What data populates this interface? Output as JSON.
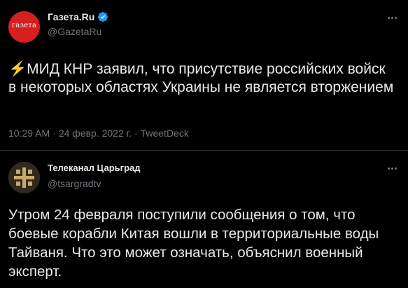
{
  "tweet1": {
    "avatar_text": "газета",
    "name": "Газета.Ru",
    "handle": "@GazetaRu",
    "bolt": "⚡",
    "text": "МИД КНР заявил, что присутствие российских войск в некоторых областях Украины не является вторжением",
    "time": "10:29 AM",
    "date": "24 февр. 2022 г.",
    "source": "TweetDeck",
    "separator": "·",
    "icons": {
      "verified": "verified-badge-icon",
      "more": "more-dots-icon"
    }
  },
  "tweet2": {
    "name": "Телеканал Царьград",
    "handle": "@tsargradtv",
    "text": "Утром 24 февраля поступили сообщения о том, что боевые корабли Китая вошли в территориальные воды Тайваня. Что это может означать, объяснил военный эксперт.",
    "icons": {
      "logo": "cross-emblem-icon",
      "more": "more-dots-icon"
    }
  },
  "colors": {
    "background": "#000000",
    "text": "#e7e9ea",
    "muted": "#71767b",
    "verified": "#1d9bf0",
    "gazeta_red": "#d61f1f",
    "tsargrad_gold": "#c9a96a"
  }
}
